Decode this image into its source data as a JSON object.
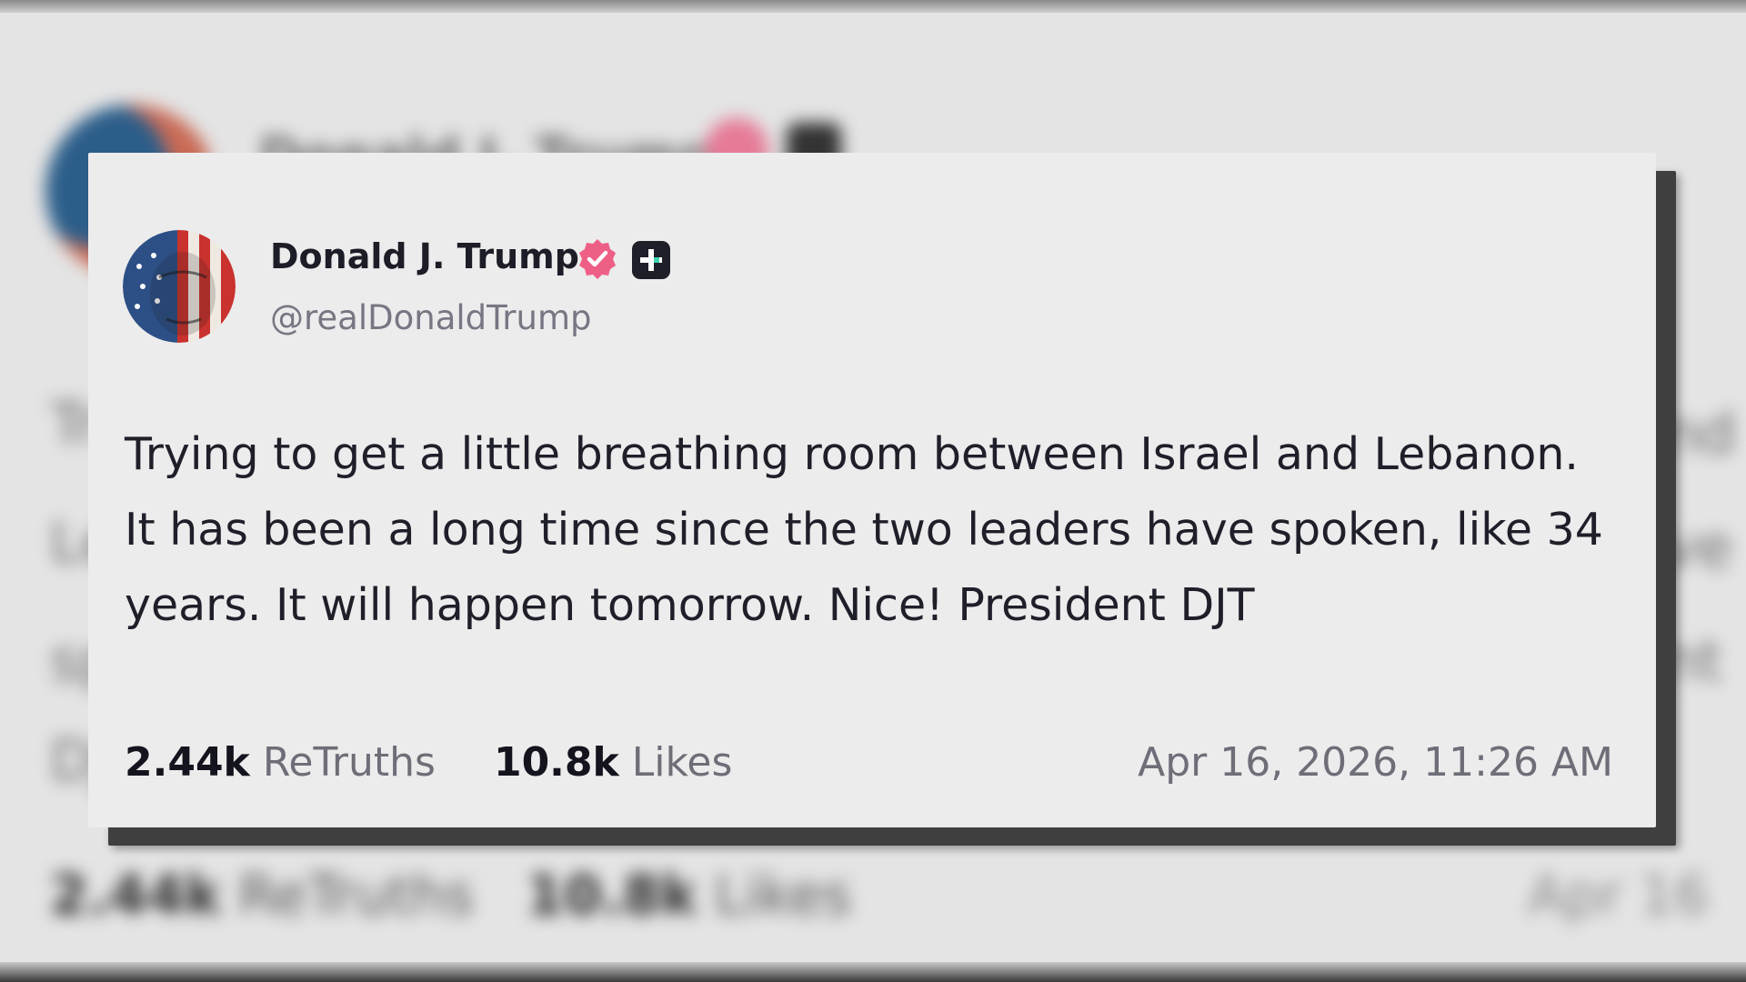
{
  "post": {
    "display_name": "Donald J. Trump",
    "handle": "@realDonaldTrump",
    "text": "Trying to get a little breathing room between Israel and Lebanon. It has been a long time since the two leaders have spoken, like 34 years. It will happen tomorrow. Nice! President DJT",
    "retruths_count": "2.44k",
    "retruths_label": "ReTruths",
    "likes_count": "10.8k",
    "likes_label": "Likes",
    "timestamp": "Apr 16, 2026, 11:26 AM"
  },
  "icons": {
    "verified": "verified-badge-icon",
    "plus": "plus-badge-icon",
    "avatar": "profile-avatar"
  },
  "colors": {
    "verified_badge": "#ee5f86",
    "plus_badge": "#1f1f2a",
    "card_background": "#ececec",
    "text_primary": "#1f1f2a",
    "text_secondary": "#6e6e78"
  }
}
